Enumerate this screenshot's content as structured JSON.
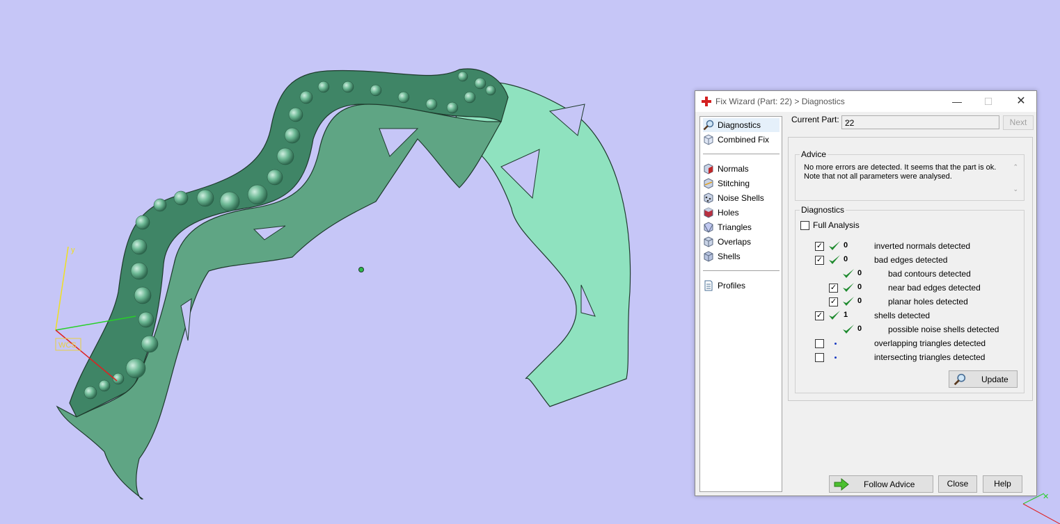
{
  "dialog": {
    "title": "Fix Wizard (Part: 22) > Diagnostics",
    "window_buttons": {
      "minimize": "—",
      "maximize": "☐",
      "close": "✕"
    }
  },
  "nav": {
    "top_items": [
      {
        "label": "Diagnostics",
        "icon": "magnifier-icon",
        "selected": true
      },
      {
        "label": "Combined Fix",
        "icon": "cube-icon"
      }
    ],
    "fix_items": [
      {
        "label": "Normals",
        "icon": "normals-cube-icon"
      },
      {
        "label": "Stitching",
        "icon": "stitching-cube-icon"
      },
      {
        "label": "Noise Shells",
        "icon": "noise-shells-cube-icon"
      },
      {
        "label": "Holes",
        "icon": "holes-cube-icon"
      },
      {
        "label": "Triangles",
        "icon": "triangles-cube-icon"
      },
      {
        "label": "Overlaps",
        "icon": "overlaps-cube-icon"
      },
      {
        "label": "Shells",
        "icon": "shells-cube-icon"
      }
    ],
    "bottom_items": [
      {
        "label": "Profiles",
        "icon": "document-icon"
      }
    ]
  },
  "current_part": {
    "label": "Current Part:",
    "value": "22",
    "next_label": "Next"
  },
  "advice": {
    "title": "Advice",
    "text": "No more errors are detected. It seems that the part is ok.\nNote that not all parameters were analysed."
  },
  "diagnostics": {
    "title": "Diagnostics",
    "full_analysis": {
      "label": "Full Analysis",
      "checked": false
    },
    "rows": [
      {
        "checkbox": true,
        "checked": true,
        "status": "ok",
        "count": "0",
        "label": "inverted normals detected",
        "indent": 0
      },
      {
        "checkbox": true,
        "checked": true,
        "status": "ok",
        "count": "0",
        "label": "bad edges detected",
        "indent": 0
      },
      {
        "checkbox": false,
        "checked": false,
        "status": "ok",
        "count": "0",
        "label": "bad contours detected",
        "indent": 1
      },
      {
        "checkbox": true,
        "checked": true,
        "status": "ok",
        "count": "0",
        "label": "near bad edges detected",
        "indent": 1
      },
      {
        "checkbox": true,
        "checked": true,
        "status": "ok",
        "count": "0",
        "label": "planar holes detected",
        "indent": 1
      },
      {
        "checkbox": true,
        "checked": true,
        "status": "ok",
        "count": "1",
        "label": "shells detected",
        "indent": 0
      },
      {
        "checkbox": false,
        "checked": false,
        "status": "ok",
        "count": "0",
        "label": "possible noise shells detected",
        "indent": 1
      },
      {
        "checkbox": true,
        "checked": false,
        "status": "pending",
        "count": "",
        "label": "overlapping triangles detected",
        "indent": 0
      },
      {
        "checkbox": true,
        "checked": false,
        "status": "pending",
        "count": "",
        "label": "intersecting triangles detected",
        "indent": 0
      }
    ],
    "update_label": "Update"
  },
  "footer": {
    "follow_advice": "Follow Advice",
    "close": "Close",
    "help": "Help"
  },
  "viewport": {
    "axis_y": "y",
    "axis_tag": "WCS",
    "model_color": "#5fa584",
    "background": "#c6c6f7"
  }
}
